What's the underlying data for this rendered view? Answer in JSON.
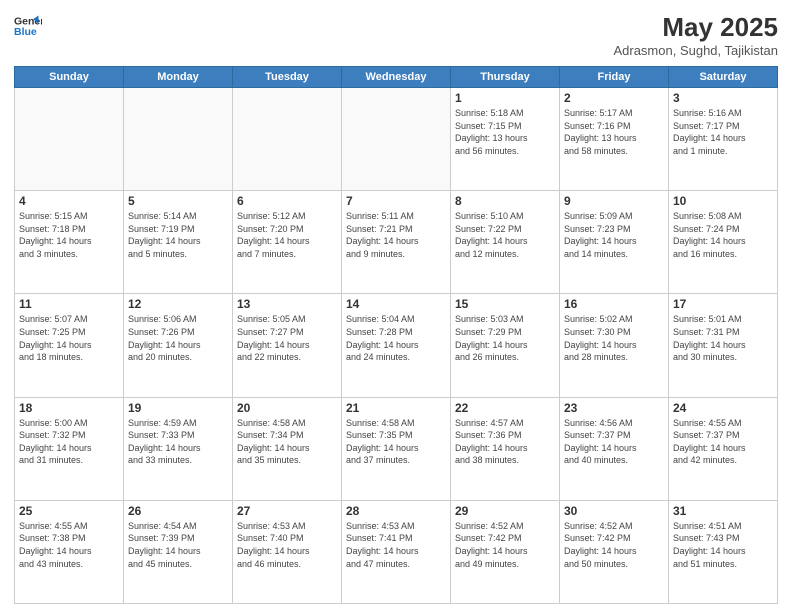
{
  "header": {
    "logo_line1": "General",
    "logo_line2": "Blue",
    "month_year": "May 2025",
    "location": "Adrasmon, Sughd, Tajikistan"
  },
  "weekdays": [
    "Sunday",
    "Monday",
    "Tuesday",
    "Wednesday",
    "Thursday",
    "Friday",
    "Saturday"
  ],
  "weeks": [
    [
      {
        "day": "",
        "info": ""
      },
      {
        "day": "",
        "info": ""
      },
      {
        "day": "",
        "info": ""
      },
      {
        "day": "",
        "info": ""
      },
      {
        "day": "1",
        "info": "Sunrise: 5:18 AM\nSunset: 7:15 PM\nDaylight: 13 hours\nand 56 minutes."
      },
      {
        "day": "2",
        "info": "Sunrise: 5:17 AM\nSunset: 7:16 PM\nDaylight: 13 hours\nand 58 minutes."
      },
      {
        "day": "3",
        "info": "Sunrise: 5:16 AM\nSunset: 7:17 PM\nDaylight: 14 hours\nand 1 minute."
      }
    ],
    [
      {
        "day": "4",
        "info": "Sunrise: 5:15 AM\nSunset: 7:18 PM\nDaylight: 14 hours\nand 3 minutes."
      },
      {
        "day": "5",
        "info": "Sunrise: 5:14 AM\nSunset: 7:19 PM\nDaylight: 14 hours\nand 5 minutes."
      },
      {
        "day": "6",
        "info": "Sunrise: 5:12 AM\nSunset: 7:20 PM\nDaylight: 14 hours\nand 7 minutes."
      },
      {
        "day": "7",
        "info": "Sunrise: 5:11 AM\nSunset: 7:21 PM\nDaylight: 14 hours\nand 9 minutes."
      },
      {
        "day": "8",
        "info": "Sunrise: 5:10 AM\nSunset: 7:22 PM\nDaylight: 14 hours\nand 12 minutes."
      },
      {
        "day": "9",
        "info": "Sunrise: 5:09 AM\nSunset: 7:23 PM\nDaylight: 14 hours\nand 14 minutes."
      },
      {
        "day": "10",
        "info": "Sunrise: 5:08 AM\nSunset: 7:24 PM\nDaylight: 14 hours\nand 16 minutes."
      }
    ],
    [
      {
        "day": "11",
        "info": "Sunrise: 5:07 AM\nSunset: 7:25 PM\nDaylight: 14 hours\nand 18 minutes."
      },
      {
        "day": "12",
        "info": "Sunrise: 5:06 AM\nSunset: 7:26 PM\nDaylight: 14 hours\nand 20 minutes."
      },
      {
        "day": "13",
        "info": "Sunrise: 5:05 AM\nSunset: 7:27 PM\nDaylight: 14 hours\nand 22 minutes."
      },
      {
        "day": "14",
        "info": "Sunrise: 5:04 AM\nSunset: 7:28 PM\nDaylight: 14 hours\nand 24 minutes."
      },
      {
        "day": "15",
        "info": "Sunrise: 5:03 AM\nSunset: 7:29 PM\nDaylight: 14 hours\nand 26 minutes."
      },
      {
        "day": "16",
        "info": "Sunrise: 5:02 AM\nSunset: 7:30 PM\nDaylight: 14 hours\nand 28 minutes."
      },
      {
        "day": "17",
        "info": "Sunrise: 5:01 AM\nSunset: 7:31 PM\nDaylight: 14 hours\nand 30 minutes."
      }
    ],
    [
      {
        "day": "18",
        "info": "Sunrise: 5:00 AM\nSunset: 7:32 PM\nDaylight: 14 hours\nand 31 minutes."
      },
      {
        "day": "19",
        "info": "Sunrise: 4:59 AM\nSunset: 7:33 PM\nDaylight: 14 hours\nand 33 minutes."
      },
      {
        "day": "20",
        "info": "Sunrise: 4:58 AM\nSunset: 7:34 PM\nDaylight: 14 hours\nand 35 minutes."
      },
      {
        "day": "21",
        "info": "Sunrise: 4:58 AM\nSunset: 7:35 PM\nDaylight: 14 hours\nand 37 minutes."
      },
      {
        "day": "22",
        "info": "Sunrise: 4:57 AM\nSunset: 7:36 PM\nDaylight: 14 hours\nand 38 minutes."
      },
      {
        "day": "23",
        "info": "Sunrise: 4:56 AM\nSunset: 7:37 PM\nDaylight: 14 hours\nand 40 minutes."
      },
      {
        "day": "24",
        "info": "Sunrise: 4:55 AM\nSunset: 7:37 PM\nDaylight: 14 hours\nand 42 minutes."
      }
    ],
    [
      {
        "day": "25",
        "info": "Sunrise: 4:55 AM\nSunset: 7:38 PM\nDaylight: 14 hours\nand 43 minutes."
      },
      {
        "day": "26",
        "info": "Sunrise: 4:54 AM\nSunset: 7:39 PM\nDaylight: 14 hours\nand 45 minutes."
      },
      {
        "day": "27",
        "info": "Sunrise: 4:53 AM\nSunset: 7:40 PM\nDaylight: 14 hours\nand 46 minutes."
      },
      {
        "day": "28",
        "info": "Sunrise: 4:53 AM\nSunset: 7:41 PM\nDaylight: 14 hours\nand 47 minutes."
      },
      {
        "day": "29",
        "info": "Sunrise: 4:52 AM\nSunset: 7:42 PM\nDaylight: 14 hours\nand 49 minutes."
      },
      {
        "day": "30",
        "info": "Sunrise: 4:52 AM\nSunset: 7:42 PM\nDaylight: 14 hours\nand 50 minutes."
      },
      {
        "day": "31",
        "info": "Sunrise: 4:51 AM\nSunset: 7:43 PM\nDaylight: 14 hours\nand 51 minutes."
      }
    ]
  ]
}
